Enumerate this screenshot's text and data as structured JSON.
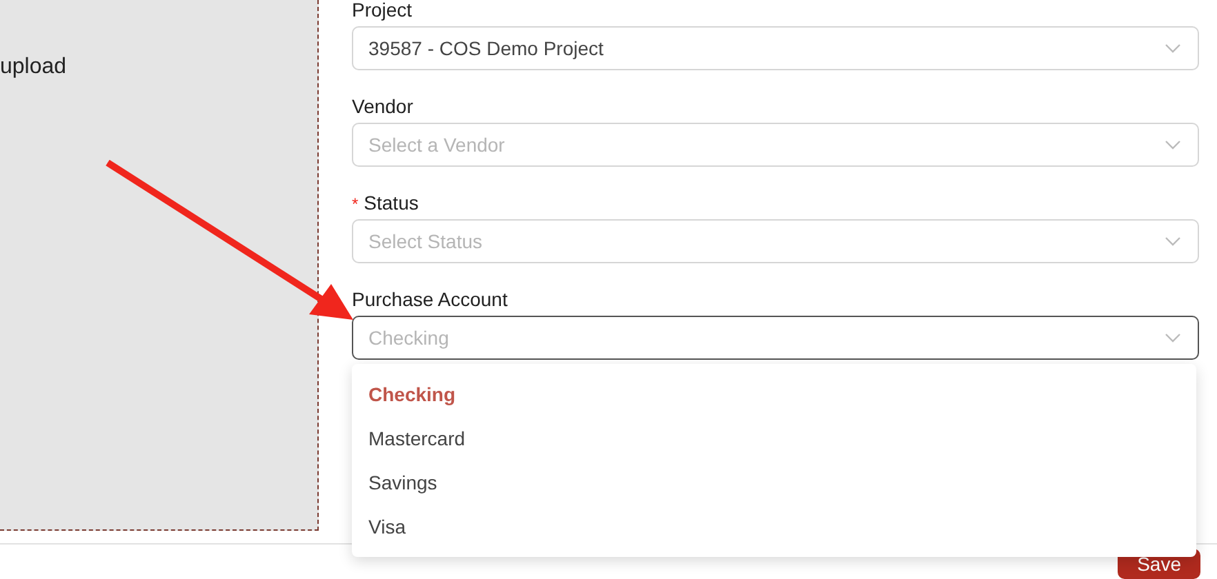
{
  "upload_area": {
    "text": "upload"
  },
  "form": {
    "fields": [
      {
        "label": "Project",
        "value": "39587 - COS Demo Project",
        "focused": false
      },
      {
        "label": "Vendor",
        "placeholder": "Select a Vendor",
        "focused": false
      },
      {
        "label": "Status",
        "required_mark": "*",
        "placeholder": "Select Status",
        "focused": false
      },
      {
        "label": "Purchase Account",
        "placeholder": "Checking",
        "focused": true
      }
    ]
  },
  "dropdown": {
    "options": [
      {
        "label": "Checking",
        "selected": true
      },
      {
        "label": "Mastercard",
        "selected": false
      },
      {
        "label": "Savings",
        "selected": false
      },
      {
        "label": "Visa",
        "selected": false
      }
    ]
  },
  "footer": {
    "buttons": [
      "Save"
    ]
  }
}
